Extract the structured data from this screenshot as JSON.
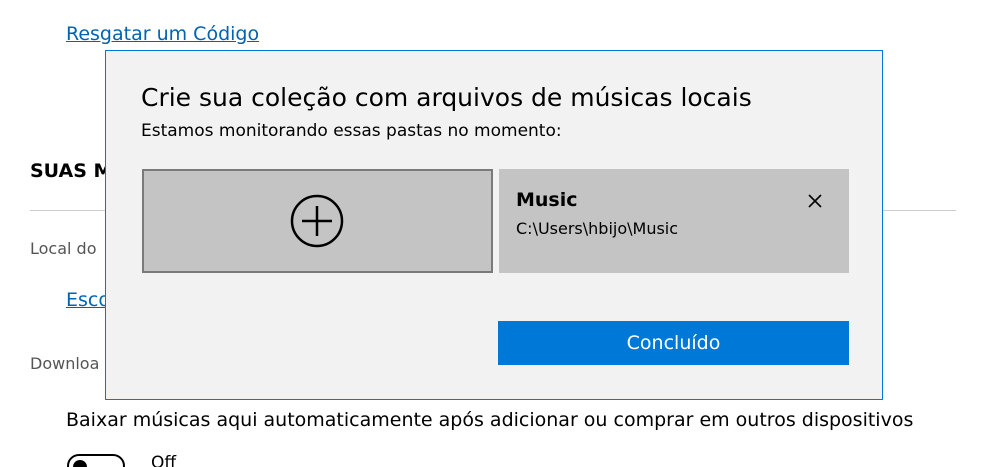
{
  "background": {
    "redeem_link": "Resgatar um Código",
    "section_title": "SUAS M",
    "location_label": "Local do",
    "choose_link": "Esco",
    "downloads_label": "Downloa",
    "auto_download_text": "Baixar músicas aqui automaticamente após adicionar ou comprar em outros dispositivos",
    "toggle_state": "Off"
  },
  "dialog": {
    "title": "Crie sua coleção com arquivos de músicas locais",
    "subtitle": "Estamos monitorando essas pastas no momento:",
    "add_folder_icon": "plus-circle-icon",
    "folders": [
      {
        "name": "Music",
        "path": "C:\\Users\\hbijo\\Music",
        "remove_icon": "close-icon"
      }
    ],
    "done_label": "Concluído"
  },
  "colors": {
    "accent": "#0078d7",
    "link": "#0063b1",
    "dialog_bg": "#f2f2f2",
    "tile_bg": "#c4c4c4"
  }
}
